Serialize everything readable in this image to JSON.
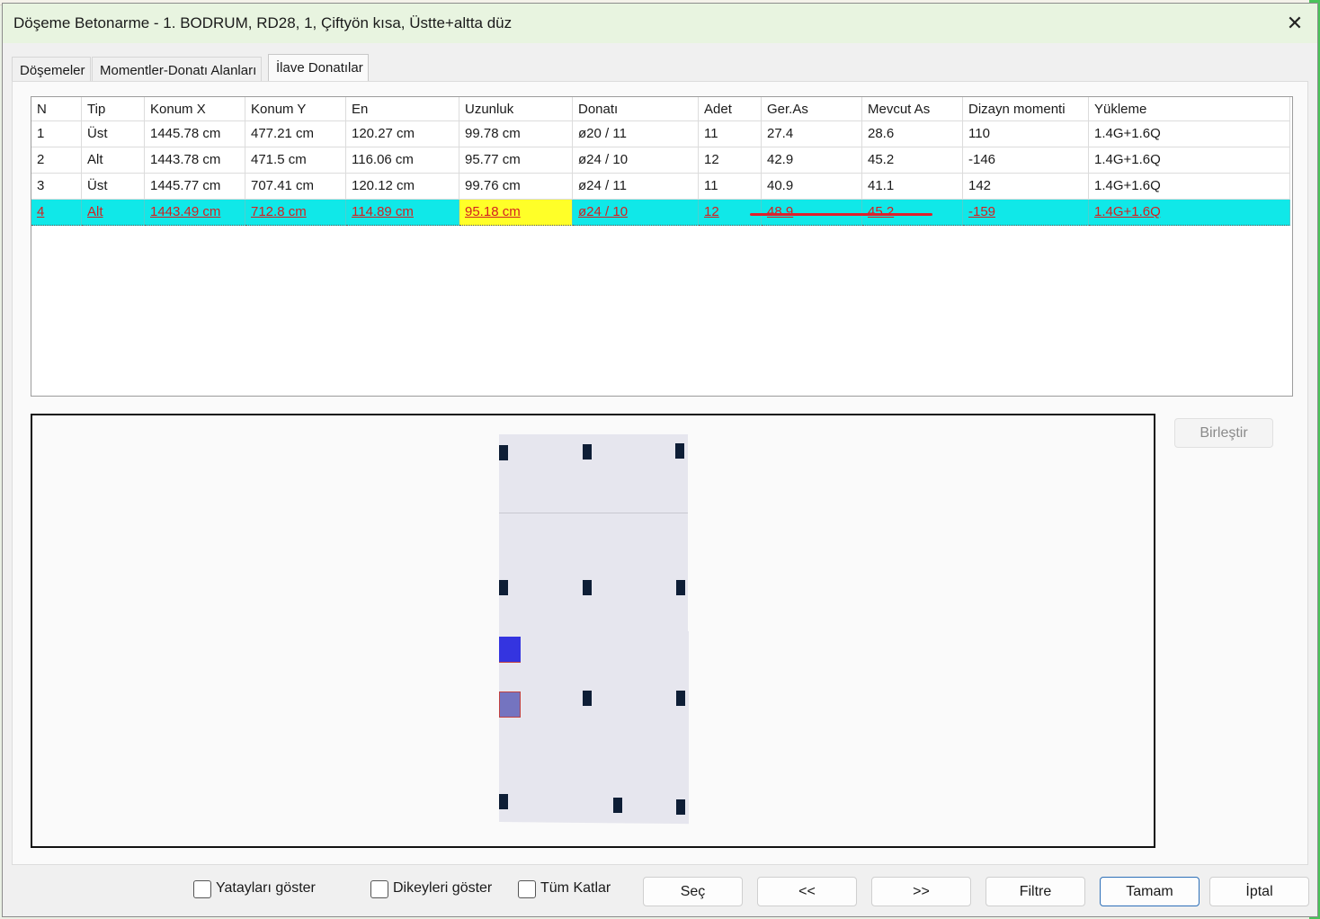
{
  "window": {
    "title": "Döşeme Betonarme - 1. BODRUM, RD28, 1, Çiftyön kısa, Üstte+altta düz"
  },
  "tabs": [
    "Döşemeler",
    "Momentler-Donatı Alanları",
    "İlave Donatılar"
  ],
  "active_tab": 2,
  "table": {
    "columns": [
      "N",
      "Tip",
      "Konum X",
      "Konum Y",
      "En",
      "Uzunluk",
      "Donatı",
      "Adet",
      "Ger.As",
      "Mevcut As",
      "Dizayn momenti",
      "Yükleme"
    ],
    "rows": [
      [
        "1",
        "Üst",
        "1445.78 cm",
        "477.21 cm",
        "120.27 cm",
        "99.78 cm",
        "ø20 / 11",
        "11",
        "27.4",
        "28.6",
        "110",
        "1.4G+1.6Q"
      ],
      [
        "2",
        "Alt",
        "1443.78 cm",
        "471.5 cm",
        "116.06 cm",
        "95.77 cm",
        "ø24 / 10",
        "12",
        "42.9",
        "45.2",
        "-146",
        "1.4G+1.6Q"
      ],
      [
        "3",
        "Üst",
        "1445.77 cm",
        "707.41 cm",
        "120.12 cm",
        "99.76 cm",
        "ø24 / 11",
        "11",
        "40.9",
        "41.1",
        "142",
        "1.4G+1.6Q"
      ],
      [
        "4",
        "Alt",
        "1443.49 cm",
        "712.8 cm",
        "114.89 cm",
        "95.18 cm",
        "ø24 / 10",
        "12",
        "48.9",
        "45.2",
        "-159",
        "1.4G+1.6Q"
      ]
    ],
    "selected_row": 3,
    "highlight_cell_column": 5
  },
  "buttons": {
    "merge": "Birleştir",
    "select": "Seç",
    "prev": "<<",
    "next": ">>",
    "filter": "Filtre",
    "ok": "Tamam",
    "cancel": "İptal"
  },
  "checkboxes": {
    "horizontal": {
      "label": "Yatayları göster",
      "checked": false
    },
    "vertical": {
      "label": "Dikeyleri göster",
      "checked": false
    },
    "all_floors": {
      "label": "Tüm Katlar",
      "checked": false
    }
  },
  "colors": {
    "selection": "#10e8e8",
    "selected_text": "#d42020",
    "highlight_cell": "#ffff28",
    "column": "#0e1e36",
    "block_upper": "#3434e0",
    "block_lower": "#7474c0",
    "annotation_line": "#e0202c"
  }
}
